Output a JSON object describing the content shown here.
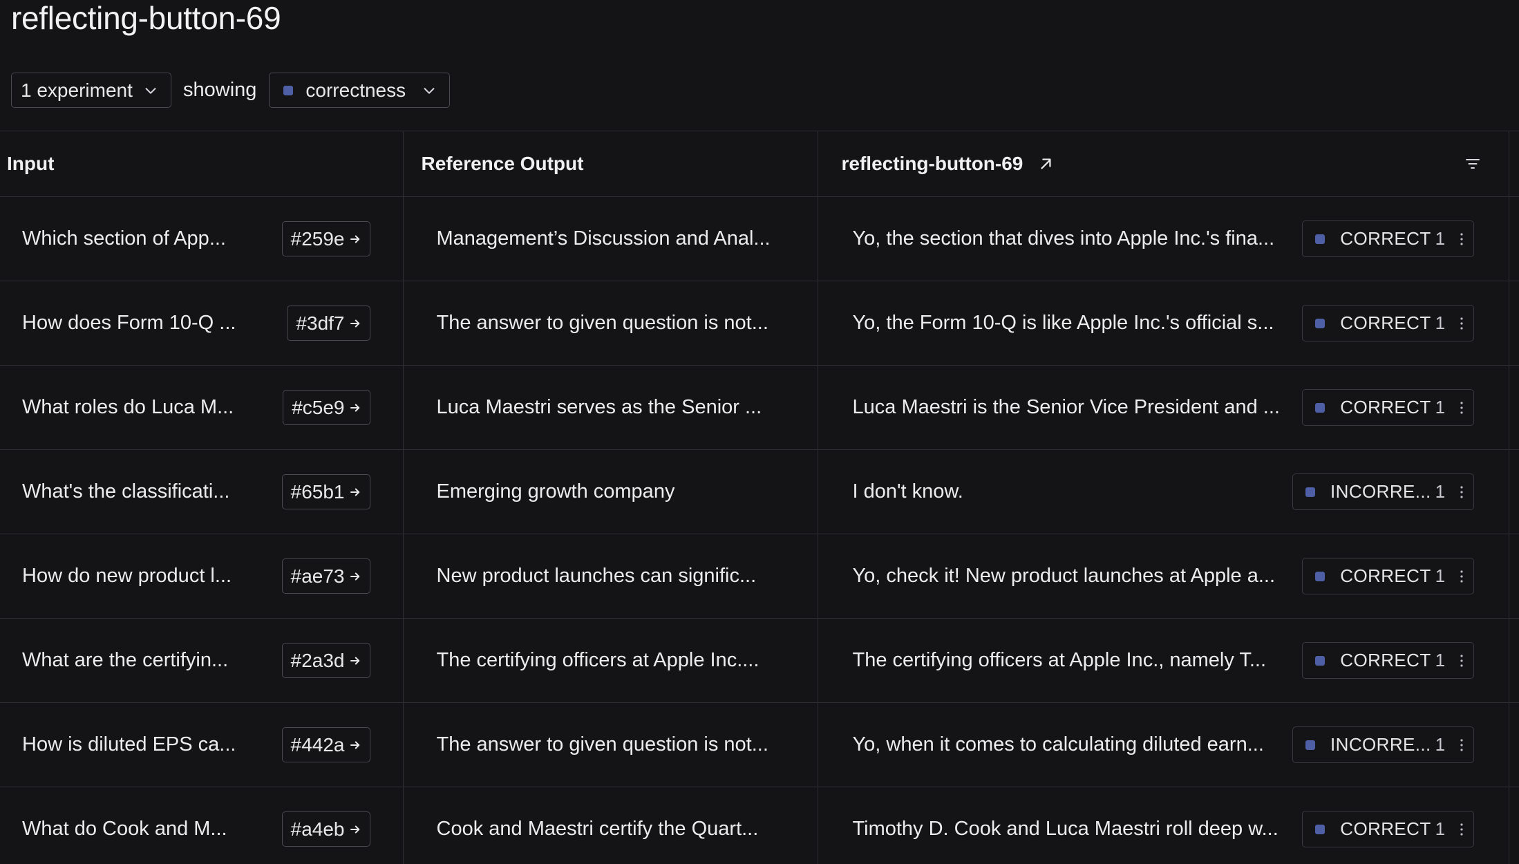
{
  "page": {
    "title": "reflecting-button-69"
  },
  "controls": {
    "experiments_label": "1 experiment",
    "showing_label": "showing",
    "metric_label": "correctness",
    "metric_color": "#4f5fa6"
  },
  "table": {
    "headers": {
      "input": "Input",
      "reference": "Reference Output",
      "experiment": "reflecting-button-69"
    },
    "rows": [
      {
        "input": "Which section of App...",
        "id": "#259e",
        "reference": "Management’s Discussion and Anal...",
        "output": "Yo, the section that dives into Apple Inc.'s fina...",
        "result": "CORRECT",
        "score": "1"
      },
      {
        "input": "How does Form 10-Q ...",
        "id": "#3df7",
        "reference": "The answer to given question is not...",
        "output": "Yo, the Form 10-Q is like Apple Inc.'s official s...",
        "result": "CORRECT",
        "score": "1"
      },
      {
        "input": "What roles do Luca M...",
        "id": "#c5e9",
        "reference": "Luca Maestri serves as the Senior ...",
        "output": "Luca Maestri is the Senior Vice President and ...",
        "result": "CORRECT",
        "score": "1"
      },
      {
        "input": "What's the classificati...",
        "id": "#65b1",
        "reference": "Emerging growth company",
        "output": "I don't know.",
        "result": "INCORRE...",
        "score": "1"
      },
      {
        "input": "How do new product l...",
        "id": "#ae73",
        "reference": "New product launches can signific...",
        "output": "Yo, check it! New product launches at Apple a...",
        "result": "CORRECT",
        "score": "1"
      },
      {
        "input": "What are the certifyin...",
        "id": "#2a3d",
        "reference": "The certifying officers at Apple Inc....",
        "output": "The certifying officers at Apple Inc., namely T...",
        "result": "CORRECT",
        "score": "1"
      },
      {
        "input": "How is diluted EPS ca...",
        "id": "#442a",
        "reference": "The answer to given question is not...",
        "output": "Yo, when it comes to calculating diluted earn...",
        "result": "INCORRE...",
        "score": "1"
      },
      {
        "input": "What do Cook and M...",
        "id": "#a4eb",
        "reference": "Cook and Maestri certify the Quart...",
        "output": "Timothy D. Cook and Luca Maestri roll deep w...",
        "result": "CORRECT",
        "score": "1"
      }
    ]
  },
  "icons": {
    "dropdown": "chevron-down-icon",
    "open_experiment": "external-arrow-icon",
    "filter": "filter-icon",
    "id_link": "arrow-right-icon",
    "more": "kebab-menu-icon"
  }
}
